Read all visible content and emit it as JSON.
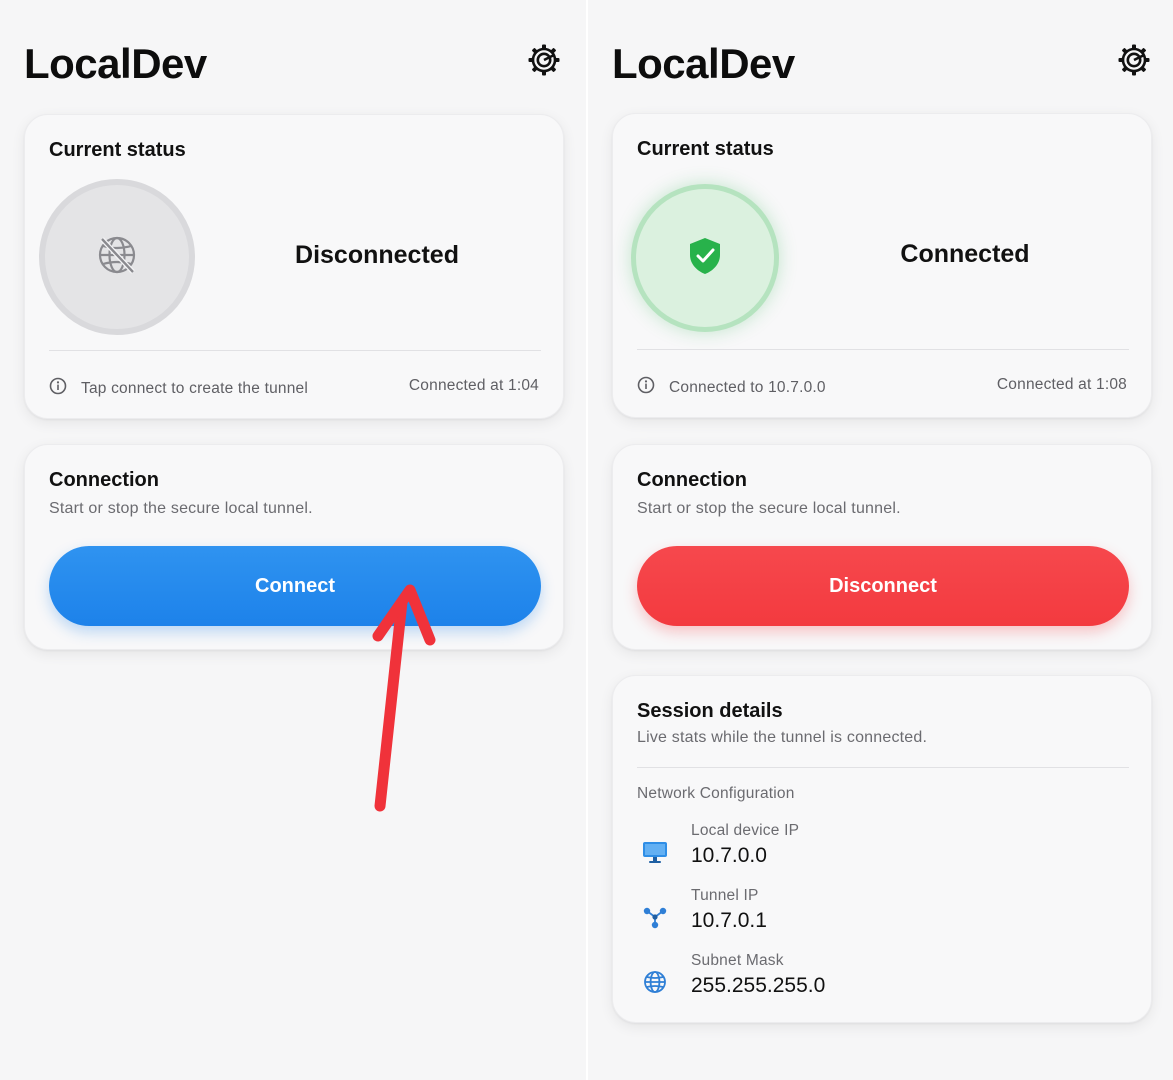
{
  "colors": {
    "accent_blue": "#1d82ea",
    "accent_red": "#f33a3f",
    "status_green": "#28b24b",
    "annotation_arrow": "#f0323a"
  },
  "left": {
    "app_title": "LocalDev",
    "settings_icon": "gear-icon",
    "status_card": {
      "title": "Current status",
      "status_icon": "globe-slash-icon",
      "status": "Disconnected",
      "info_icon": "info-icon",
      "info_text": "Tap connect to create the tunnel",
      "time_text": "Connected at 1:04"
    },
    "connection_card": {
      "title": "Connection",
      "subtitle": "Start or stop the secure local tunnel.",
      "button_label": "Connect"
    }
  },
  "right": {
    "app_title": "LocalDev",
    "settings_icon": "gear-icon",
    "status_card": {
      "title": "Current status",
      "status_icon": "shield-check-icon",
      "status": "Connected",
      "info_icon": "info-icon",
      "info_text": "Connected to 10.7.0.0",
      "time_text": "Connected at 1:08"
    },
    "connection_card": {
      "title": "Connection",
      "subtitle": "Start or stop the secure local tunnel.",
      "button_label": "Disconnect"
    },
    "session_card": {
      "title": "Session details",
      "subtitle": "Live stats while the tunnel is connected.",
      "section_label": "Network Configuration",
      "rows": [
        {
          "icon": "monitor-icon",
          "label": "Local device IP",
          "value": "10.7.0.0"
        },
        {
          "icon": "network-nodes-icon",
          "label": "Tunnel IP",
          "value": "10.7.0.1"
        },
        {
          "icon": "globe-icon",
          "label": "Subnet Mask",
          "value": "255.255.255.0"
        }
      ]
    }
  }
}
